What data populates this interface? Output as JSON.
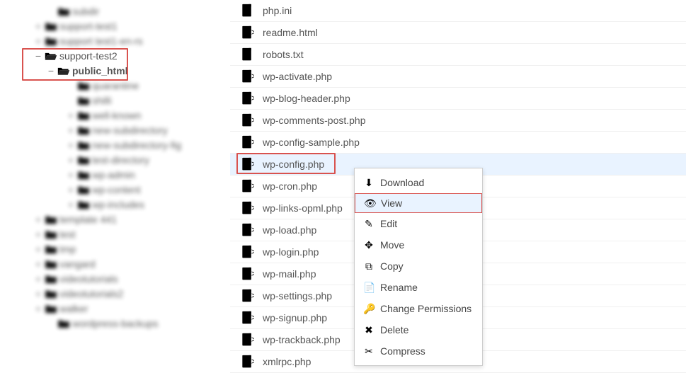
{
  "sidebar": {
    "items": [
      {
        "label": "subdir",
        "depth": 2,
        "toggle": "",
        "blur": true,
        "bold": false,
        "open": false
      },
      {
        "label": "support-test1",
        "depth": 1,
        "toggle": "+",
        "blur": true,
        "bold": false,
        "open": false
      },
      {
        "label": "support test1-en-rs",
        "depth": 1,
        "toggle": "+",
        "blur": true,
        "bold": false,
        "open": false
      },
      {
        "label": "support-test2",
        "depth": 1,
        "toggle": "−",
        "blur": false,
        "bold": false,
        "open": true
      },
      {
        "label": "public_html",
        "depth": 2,
        "toggle": "−",
        "blur": false,
        "bold": true,
        "open": true
      },
      {
        "label": "quarantine",
        "depth": 3,
        "toggle": "",
        "blur": true,
        "bold": false,
        "open": false
      },
      {
        "label": "shilli",
        "depth": 3,
        "toggle": "",
        "blur": true,
        "bold": false,
        "open": false
      },
      {
        "label": "well-known",
        "depth": 3,
        "toggle": "+",
        "blur": true,
        "bold": false,
        "open": false
      },
      {
        "label": "new-subdirectory",
        "depth": 3,
        "toggle": "+",
        "blur": true,
        "bold": false,
        "open": false
      },
      {
        "label": "new-subdirectory-fig",
        "depth": 3,
        "toggle": "+",
        "blur": true,
        "bold": false,
        "open": false
      },
      {
        "label": "test-directory",
        "depth": 3,
        "toggle": "+",
        "blur": true,
        "bold": false,
        "open": false
      },
      {
        "label": "wp-admin",
        "depth": 3,
        "toggle": "+",
        "blur": true,
        "bold": false,
        "open": false
      },
      {
        "label": "wp-content",
        "depth": 3,
        "toggle": "+",
        "blur": true,
        "bold": false,
        "open": false
      },
      {
        "label": "wp-includes",
        "depth": 3,
        "toggle": "+",
        "blur": true,
        "bold": false,
        "open": false
      },
      {
        "label": "template 441",
        "depth": 1,
        "toggle": "+",
        "blur": true,
        "bold": false,
        "open": false
      },
      {
        "label": "test",
        "depth": 1,
        "toggle": "+",
        "blur": true,
        "bold": false,
        "open": false
      },
      {
        "label": "tmp",
        "depth": 1,
        "toggle": "+",
        "blur": true,
        "bold": false,
        "open": false
      },
      {
        "label": "vangard",
        "depth": 1,
        "toggle": "+",
        "blur": true,
        "bold": false,
        "open": false
      },
      {
        "label": "videotutorials",
        "depth": 1,
        "toggle": "+",
        "blur": true,
        "bold": false,
        "open": false
      },
      {
        "label": "videotutorials2",
        "depth": 1,
        "toggle": "+",
        "blur": true,
        "bold": false,
        "open": false
      },
      {
        "label": "walker",
        "depth": 1,
        "toggle": "+",
        "blur": true,
        "bold": false,
        "open": false
      },
      {
        "label": "wordpress-backups",
        "depth": 2,
        "toggle": "",
        "blur": true,
        "bold": false,
        "open": false
      }
    ]
  },
  "files": [
    {
      "name": "php.ini",
      "kind": "plain",
      "selected": false
    },
    {
      "name": "readme.html",
      "kind": "code",
      "selected": false
    },
    {
      "name": "robots.txt",
      "kind": "plain",
      "selected": false
    },
    {
      "name": "wp-activate.php",
      "kind": "code",
      "selected": false
    },
    {
      "name": "wp-blog-header.php",
      "kind": "code",
      "selected": false
    },
    {
      "name": "wp-comments-post.php",
      "kind": "code",
      "selected": false
    },
    {
      "name": "wp-config-sample.php",
      "kind": "code",
      "selected": false
    },
    {
      "name": "wp-config.php",
      "kind": "code",
      "selected": true
    },
    {
      "name": "wp-cron.php",
      "kind": "code",
      "selected": false
    },
    {
      "name": "wp-links-opml.php",
      "kind": "code",
      "selected": false
    },
    {
      "name": "wp-load.php",
      "kind": "code",
      "selected": false
    },
    {
      "name": "wp-login.php",
      "kind": "code",
      "selected": false
    },
    {
      "name": "wp-mail.php",
      "kind": "code",
      "selected": false
    },
    {
      "name": "wp-settings.php",
      "kind": "code",
      "selected": false
    },
    {
      "name": "wp-signup.php",
      "kind": "code",
      "selected": false
    },
    {
      "name": "wp-trackback.php",
      "kind": "code",
      "selected": false
    },
    {
      "name": "xmlrpc.php",
      "kind": "code",
      "selected": false
    }
  ],
  "context_menu": {
    "items": [
      {
        "label": "Download",
        "icon": "download-icon",
        "hover": false
      },
      {
        "label": "View",
        "icon": "view-icon",
        "hover": true
      },
      {
        "label": "Edit",
        "icon": "edit-icon",
        "hover": false
      },
      {
        "label": "Move",
        "icon": "move-icon",
        "hover": false
      },
      {
        "label": "Copy",
        "icon": "copy-icon",
        "hover": false
      },
      {
        "label": "Rename",
        "icon": "rename-icon",
        "hover": false
      },
      {
        "label": "Change Permissions",
        "icon": "permissions-icon",
        "hover": false
      },
      {
        "label": "Delete",
        "icon": "delete-icon",
        "hover": false
      },
      {
        "label": "Compress",
        "icon": "compress-icon",
        "hover": false
      }
    ]
  },
  "icon_glyphs": {
    "download-icon": "⬇",
    "view-icon": "👁",
    "edit-icon": "✎",
    "move-icon": "✥",
    "copy-icon": "⧉",
    "rename-icon": "📄",
    "permissions-icon": "🔑",
    "delete-icon": "✖",
    "compress-icon": "✂"
  }
}
